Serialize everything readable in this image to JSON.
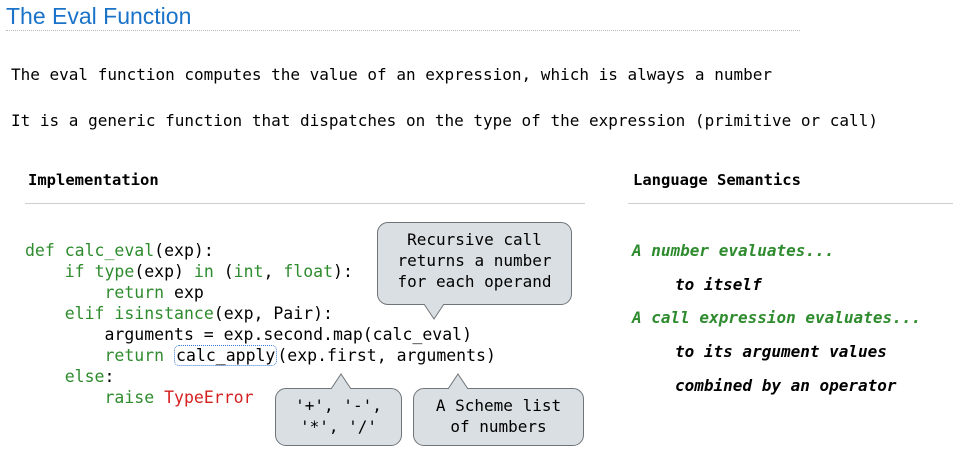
{
  "slide": {
    "title": "The Eval Function",
    "line1": "The eval function computes the value of an expression, which is always a number",
    "line2": "It is a generic function that dispatches on the type of the expression (primitive or call)"
  },
  "implementation": {
    "header": "Implementation",
    "code": {
      "l1_kw": "def ",
      "l1_fn": "calc_eval",
      "l1_rest": "(exp):",
      "l2_indent": "    ",
      "l2_kw": "if ",
      "l2_b1": "type",
      "l2_t1": "(exp) ",
      "l2_in": "in",
      "l2_t2": " (",
      "l2_b2": "int",
      "l2_t3": ", ",
      "l2_b3": "float",
      "l2_t4": "):",
      "l3_indent": "        ",
      "l3_kw": "return",
      "l3_rest": " exp",
      "l4_indent": "    ",
      "l4_kw": "elif ",
      "l4_b1": "isinstance",
      "l4_rest": "(exp, Pair):",
      "l5_text": "        arguments = exp.second.map(calc_eval)",
      "l6_indent": "        ",
      "l6_kw": "return ",
      "l6_hl": "calc_apply",
      "l6_rest": "(exp.first, arguments)",
      "l7_indent": "    ",
      "l7_kw": "else",
      "l7_rest": ":",
      "l8_indent": "        ",
      "l8_kw": "raise ",
      "l8_err": "TypeError"
    },
    "callouts": {
      "recursive": "Recursive call\nreturns a number\nfor each operand",
      "operators": "'+', '-',\n'*', '/'",
      "scheme_list": "A Scheme list\nof numbers"
    }
  },
  "semantics": {
    "header": "Language Semantics",
    "items": [
      "A number evaluates...",
      "to itself",
      "A call expression evaluates...",
      "to its argument values",
      "combined by an operator"
    ]
  }
}
